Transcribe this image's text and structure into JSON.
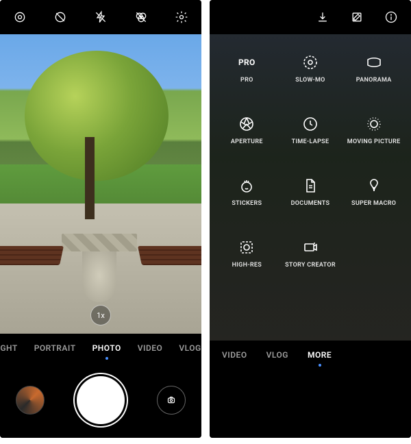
{
  "left": {
    "top_icons": [
      "motion-photo-icon",
      "flash-off-icon",
      "ai-off-icon",
      "filter-off-icon",
      "settings-icon"
    ],
    "zoom": "1x",
    "modes": [
      {
        "label": "GHT",
        "selected": false
      },
      {
        "label": "PORTRAIT",
        "selected": false
      },
      {
        "label": "PHOTO",
        "selected": true
      },
      {
        "label": "VIDEO",
        "selected": false
      },
      {
        "label": "VLOG",
        "selected": false
      }
    ]
  },
  "right": {
    "top_icons": [
      "download-icon",
      "edit-icon",
      "info-icon"
    ],
    "grid": [
      {
        "label": "PRO",
        "icon": "pro-icon"
      },
      {
        "label": "SLOW-MO",
        "icon": "slowmo-icon"
      },
      {
        "label": "PANORAMA",
        "icon": "panorama-icon"
      },
      {
        "label": "APERTURE",
        "icon": "aperture-icon"
      },
      {
        "label": "TIME-LAPSE",
        "icon": "timelapse-icon"
      },
      {
        "label": "MOVING PICTURE",
        "icon": "moving-picture-icon"
      },
      {
        "label": "STICKERS",
        "icon": "stickers-icon"
      },
      {
        "label": "DOCUMENTS",
        "icon": "documents-icon"
      },
      {
        "label": "SUPER MACRO",
        "icon": "super-macro-icon"
      },
      {
        "label": "HIGH-RES",
        "icon": "high-res-icon"
      },
      {
        "label": "STORY CREATOR",
        "icon": "story-creator-icon"
      }
    ],
    "modes": [
      {
        "label": "VIDEO",
        "selected": false
      },
      {
        "label": "VLOG",
        "selected": false
      },
      {
        "label": "MORE",
        "selected": true
      }
    ]
  }
}
